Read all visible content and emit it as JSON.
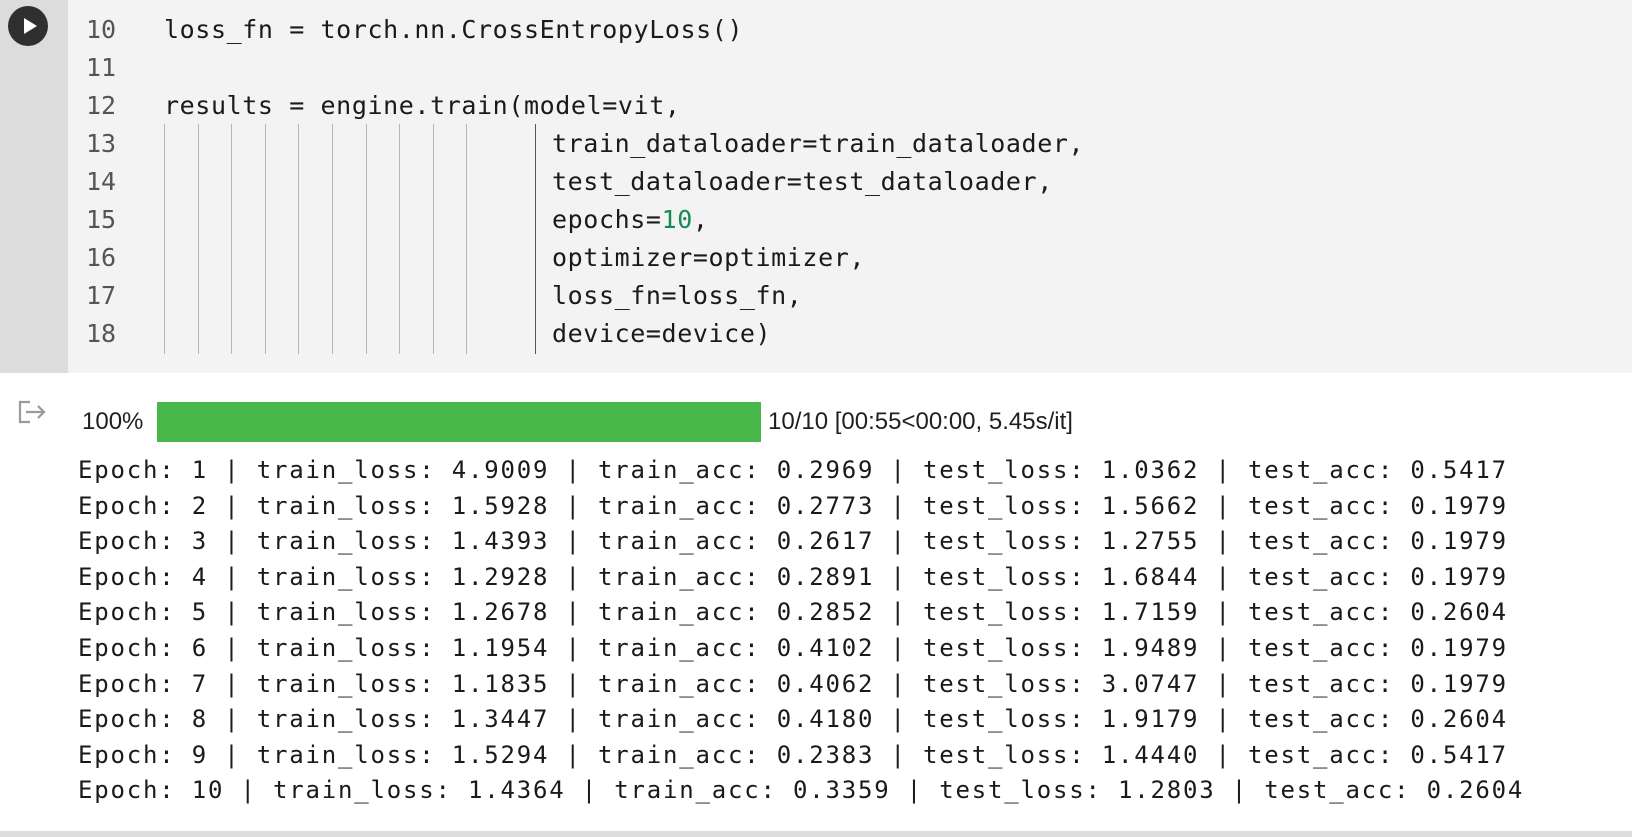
{
  "code_cell": {
    "lines": [
      {
        "num": "10",
        "code": "loss_fn = torch.nn.CrossEntropyLoss()"
      },
      {
        "num": "11",
        "code": ""
      },
      {
        "num": "12",
        "code": "results = engine.train(model=vit,"
      },
      {
        "num": "13",
        "code": "train_dataloader=train_dataloader,"
      },
      {
        "num": "14",
        "code": "test_dataloader=test_dataloader,"
      },
      {
        "num": "15",
        "code_before": "epochs=",
        "code_number": "10",
        "code_after": ","
      },
      {
        "num": "16",
        "code": "optimizer=optimizer,"
      },
      {
        "num": "17",
        "code": "loss_fn=loss_fn,"
      },
      {
        "num": "18",
        "code": "device=device)"
      }
    ],
    "colors": {
      "background": "#f3f3f3",
      "gutter": "#dcdcdc",
      "number_literal": "#148a55"
    }
  },
  "run_button": {
    "icon": "play-icon"
  },
  "output": {
    "icon": "output-redirect-icon",
    "progress": {
      "percent_label": "100%",
      "fraction": 1.0,
      "stats": "10/10 [00:55<00:00, 5.45s/it]",
      "fill_color": "#48b84a"
    },
    "log_lines": [
      "Epoch: 1 | train_loss: 4.9009 | train_acc: 0.2969 | test_loss: 1.0362 | test_acc: 0.5417",
      "Epoch: 2 | train_loss: 1.5928 | train_acc: 0.2773 | test_loss: 1.5662 | test_acc: 0.1979",
      "Epoch: 3 | train_loss: 1.4393 | train_acc: 0.2617 | test_loss: 1.2755 | test_acc: 0.1979",
      "Epoch: 4 | train_loss: 1.2928 | train_acc: 0.2891 | test_loss: 1.6844 | test_acc: 0.1979",
      "Epoch: 5 | train_loss: 1.2678 | train_acc: 0.2852 | test_loss: 1.7159 | test_acc: 0.2604",
      "Epoch: 6 | train_loss: 1.1954 | train_acc: 0.4102 | test_loss: 1.9489 | test_acc: 0.1979",
      "Epoch: 7 | train_loss: 1.1835 | train_acc: 0.4062 | test_loss: 3.0747 | test_acc: 0.1979",
      "Epoch: 8 | train_loss: 1.3447 | train_acc: 0.4180 | test_loss: 1.9179 | test_acc: 0.2604",
      "Epoch: 9 | train_loss: 1.5294 | train_acc: 0.2383 | test_loss: 1.4440 | test_acc: 0.5417",
      "Epoch: 10 | train_loss: 1.4364 | train_acc: 0.3359 | test_loss: 1.2803 | test_acc: 0.2604"
    ]
  }
}
